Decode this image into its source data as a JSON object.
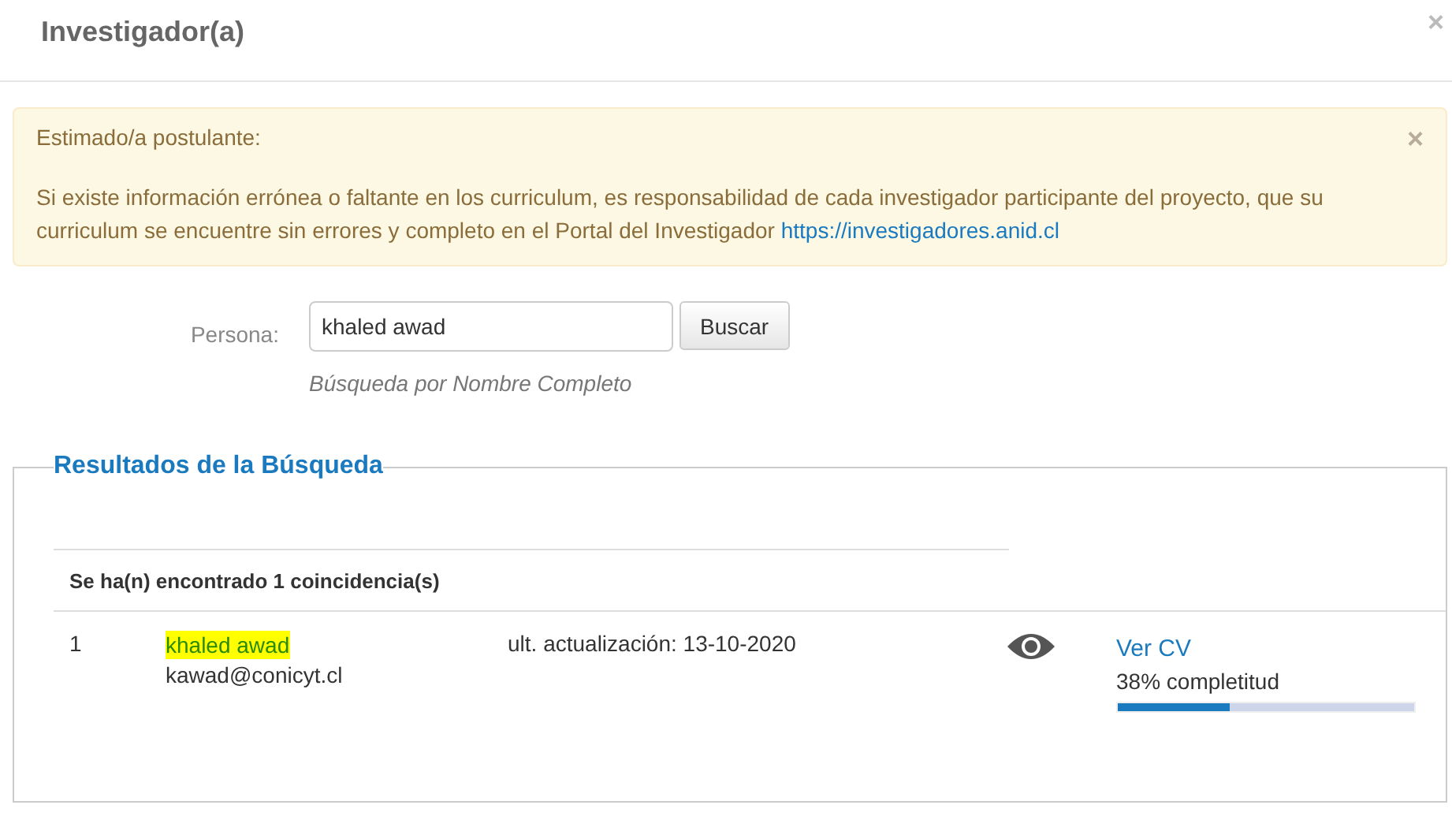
{
  "modal": {
    "title": "Investigador(a)",
    "close": "×"
  },
  "alert": {
    "heading": "Estimado/a postulante:",
    "close": "×",
    "message": "Si existe información errónea o faltante en los curriculum, es responsabilidad de cada investigador participante del proyecto, que su curriculum se encuentre sin errores y completo en el Portal del Investigador",
    "link": "https://investigadores.anid.cl"
  },
  "search": {
    "label": "Persona:",
    "value": "khaled awad",
    "button": "Buscar",
    "hint": "Búsqueda por Nombre Completo"
  },
  "results": {
    "legend": "Resultados de la Búsqueda",
    "summary": "Se ha(n) encontrado 1 coincidencia(s)",
    "rows": [
      {
        "index": "1",
        "name": "khaled awad",
        "highlighted": true,
        "email": "kawad@conicyt.cl",
        "updated": "ult. actualización: 13-10-2020",
        "link": "Ver CV",
        "completeness": "38% completitud",
        "level": 0.38
      }
    ]
  }
}
